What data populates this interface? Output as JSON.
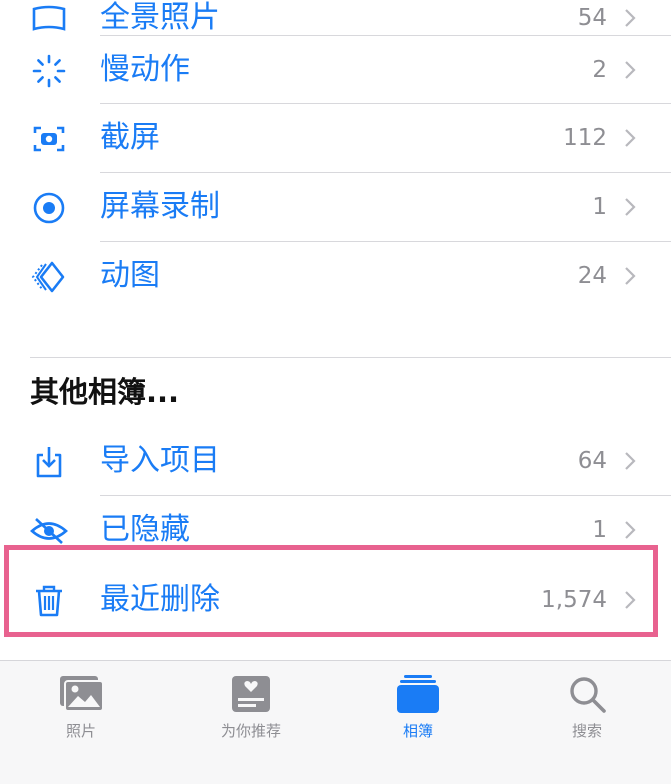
{
  "albums": [
    {
      "label": "全景照片",
      "count": "54",
      "icon": "panorama-icon"
    },
    {
      "label": "慢动作",
      "count": "2",
      "icon": "slow-motion-icon"
    },
    {
      "label": "截屏",
      "count": "112",
      "icon": "screenshot-icon"
    },
    {
      "label": "屏幕录制",
      "count": "1",
      "icon": "screen-recording-icon"
    },
    {
      "label": "动图",
      "count": "24",
      "icon": "animated-icon"
    }
  ],
  "other_section": {
    "title": "其他相簿...",
    "items": [
      {
        "label": "导入项目",
        "count": "64",
        "icon": "import-icon"
      },
      {
        "label": "已隐藏",
        "count": "1",
        "icon": "hidden-eye-icon"
      },
      {
        "label": "最近删除",
        "count": "1,574",
        "icon": "trash-icon"
      }
    ]
  },
  "tabbar": {
    "tabs": [
      {
        "label": "照片",
        "icon": "photos-icon",
        "active": false
      },
      {
        "label": "为你推荐",
        "icon": "for-you-icon",
        "active": false
      },
      {
        "label": "相簿",
        "icon": "albums-icon",
        "active": true
      },
      {
        "label": "搜索",
        "icon": "search-icon",
        "active": false
      }
    ]
  },
  "colors": {
    "accent": "#1a7cf5",
    "highlight": "#e8628f",
    "muted": "#8e8e93"
  }
}
